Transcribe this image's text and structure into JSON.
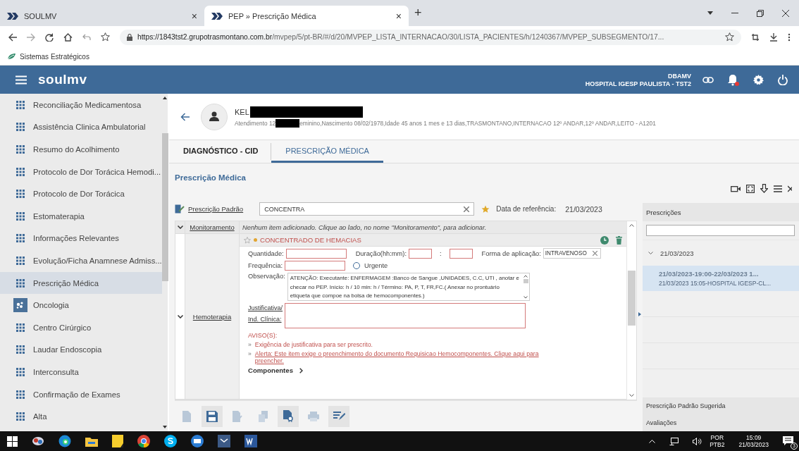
{
  "browser": {
    "tabs": [
      {
        "title": "SOULMV",
        "selected": false,
        "close": "×"
      },
      {
        "title": "PEP » Prescrição Médica",
        "selected": true,
        "close": "×"
      }
    ],
    "new_tab": "+",
    "url_host": "https://1843tst2.grupotrasmontano.com.br",
    "url_path": "/mvpep/5/pt-BR/#/d/20/MVPEP_LISTA_INTERNACAO/30/LISTA_PACIENTES/h/1240367/MVPEP_SUBSEGMENTO/17...",
    "bookmarks": [
      {
        "label": "Sistemas Estratégicos"
      }
    ]
  },
  "app_header": {
    "logo": "soulmv",
    "user": "DBAMV",
    "hospital": "HOSPITAL IGESP PAULISTA - TST2"
  },
  "sidebar": {
    "items": [
      {
        "label": "Reconciliação Medicamentosa",
        "kind": "grid",
        "selected": false
      },
      {
        "label": "Assistência Clinica Ambulatorial",
        "kind": "grid",
        "selected": false
      },
      {
        "label": "Resumo do Acolhimento",
        "kind": "grid",
        "selected": false
      },
      {
        "label": "Protocolo de Dor Torácica Hemodi...",
        "kind": "grid",
        "selected": false
      },
      {
        "label": "Protocolo de Dor Torácica",
        "kind": "grid",
        "selected": false
      },
      {
        "label": "Estomaterapia",
        "kind": "grid",
        "selected": false
      },
      {
        "label": "Informações Relevantes",
        "kind": "grid",
        "selected": false
      },
      {
        "label": "Evolução/Ficha Anamnese Admiss...",
        "kind": "grid",
        "selected": false
      },
      {
        "label": "Prescrição Médica",
        "kind": "grid",
        "selected": true
      },
      {
        "label": "Oncologia",
        "kind": "oncology",
        "selected": false
      },
      {
        "label": "Centro Cirúrgico",
        "kind": "grid",
        "selected": false
      },
      {
        "label": "Laudar Endoscopia",
        "kind": "grid",
        "selected": false
      },
      {
        "label": "Interconsulta",
        "kind": "grid",
        "selected": false
      },
      {
        "label": "Confirmação de Exames",
        "kind": "grid",
        "selected": false
      },
      {
        "label": "Alta",
        "kind": "grid",
        "selected": false
      }
    ]
  },
  "patient": {
    "name": "KEL",
    "details_start": "Atendimento 12",
    "details_end": "eminino,Nascimento 08/02/1978,Idade 45 anos 1 mes e 13 dias,TRASMONTANO,INTERNACAO 12º ANDAR,12º ANDAR,LEITO - A1201"
  },
  "tabs": [
    {
      "label": "DIAGNÓSTICO - CID",
      "selected": false
    },
    {
      "label": "PRESCRIÇÃO MÉDICA",
      "selected": true
    }
  ],
  "section_title": "Prescrição Médica",
  "standard_prescription": {
    "label": "Prescrição Padrão",
    "value": "CONCENTRA",
    "reference_label": "Data de referência:",
    "reference_date": "21/03/2023"
  },
  "groups": [
    {
      "kind": "empty",
      "name": "Monitoramento",
      "expanded": true,
      "message": "Nenhum item adicionado. Clique ao lado, no nome \"Monitoramento\", para adicionar."
    },
    {
      "kind": "item",
      "name": "Hemoterapia",
      "expanded": true,
      "item": {
        "title": "CONCENTRADO DE HEMACIAS",
        "quantity_label": "Quantidade:",
        "duration_label": "Duração(hh:mm):",
        "duration_separator": ":",
        "route_label": "Forma de aplicação:",
        "route_value": "INTRAVENOSO",
        "frequency_label": "Frequência:",
        "urgent_label": "Urgente",
        "urgent": false,
        "observation_label": "Observação:",
        "observation": "ATENÇÃO: Executante: ENFERMAGEM :Banco de Sangue ,UNIDADES, C.C, UTI , anotar  e checar no PEP. Início: h  /  10 min: h  /  Término: PA, P, T, FR,FC.( Anexar no prontuário etiqueta que compoe na bolsa de hemocomponentes.)",
        "justification_label_1": "Justificativa/",
        "justification_label_2": "Ind. Clínica:",
        "warnings_title": "AVISO(S):",
        "warnings": [
          {
            "kind": "text",
            "bullet": "»",
            "text": "Exigência de justificativa para ser prescrito."
          },
          {
            "kind": "link",
            "bullet": "»",
            "text": "Alerta: Este item exige o preenchimento do documento Requisicao Hemocomponentes. Clique aqui para preencher."
          }
        ],
        "components": "Componentes"
      }
    }
  ],
  "right_panel": {
    "title": "Prescrições",
    "groups": [
      {
        "date": "21/03/2023",
        "expanded": true,
        "items": [
          {
            "line1": "21/03/2023-19:00-22/03/2023 1...",
            "line2": "21/03/2023 15:05-HOSPITAL IGESP-CL...",
            "selected": true
          }
        ]
      }
    ],
    "sections": [
      "Prescrição Padrão Sugerida",
      "Avaliações"
    ]
  },
  "taskbar": {
    "language": "POR",
    "layout": "PTB2",
    "time": "15:09",
    "date": "21/03/2023",
    "notifications": "3"
  }
}
